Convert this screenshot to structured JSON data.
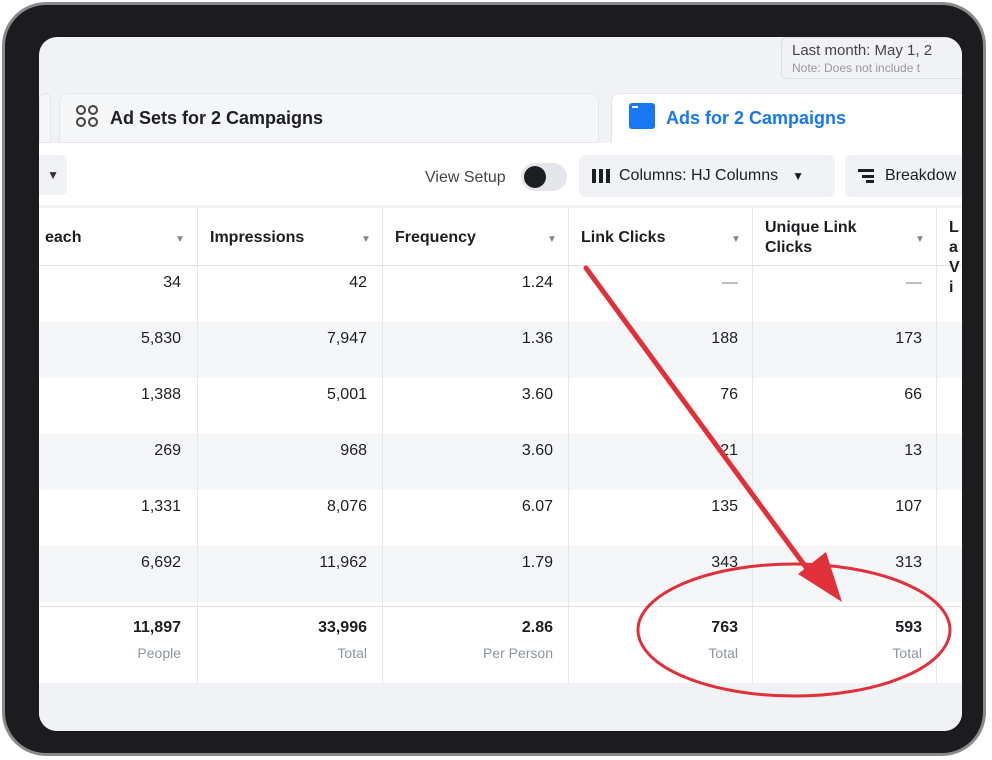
{
  "header": {
    "date_range": "Last month: May 1, 2",
    "note": "Note: Does not include t"
  },
  "tabs": [
    {
      "label": "Ad Sets for 2 Campaigns",
      "icon": "ad-sets-icon",
      "active": false
    },
    {
      "label": "Ads for 2 Campaigns",
      "icon": "ads-icon",
      "active": true
    }
  ],
  "toolbar": {
    "view_setup_label": "View Setup",
    "view_setup_on": false,
    "columns_label": "Columns: HJ Columns",
    "breakdown_label": "Breakdow"
  },
  "table": {
    "columns": [
      "each",
      "Impressions",
      "Frequency",
      "Link Clicks",
      "Unique Link Clicks",
      "La Vi"
    ],
    "rows": [
      [
        "34",
        "42",
        "1.24",
        "—",
        "—"
      ],
      [
        "5,830",
        "7,947",
        "1.36",
        "188",
        "173"
      ],
      [
        "1,388",
        "5,001",
        "3.60",
        "76",
        "66"
      ],
      [
        "269",
        "968",
        "3.60",
        "21",
        "13"
      ],
      [
        "1,331",
        "8,076",
        "6.07",
        "135",
        "107"
      ],
      [
        "6,692",
        "11,962",
        "1.79",
        "343",
        "313"
      ]
    ],
    "totals": [
      {
        "value": "11,897",
        "label": "People"
      },
      {
        "value": "33,996",
        "label": "Total"
      },
      {
        "value": "2.86",
        "label": "Per Person"
      },
      {
        "value": "763",
        "label": "Total"
      },
      {
        "value": "593",
        "label": "Total"
      }
    ]
  },
  "annotation": {
    "color": "#e0303a",
    "shapes": [
      "arrow",
      "ellipse"
    ]
  },
  "colors": {
    "accent": "#1877f2",
    "text": "#1c1e21",
    "muted": "#8d949e"
  }
}
